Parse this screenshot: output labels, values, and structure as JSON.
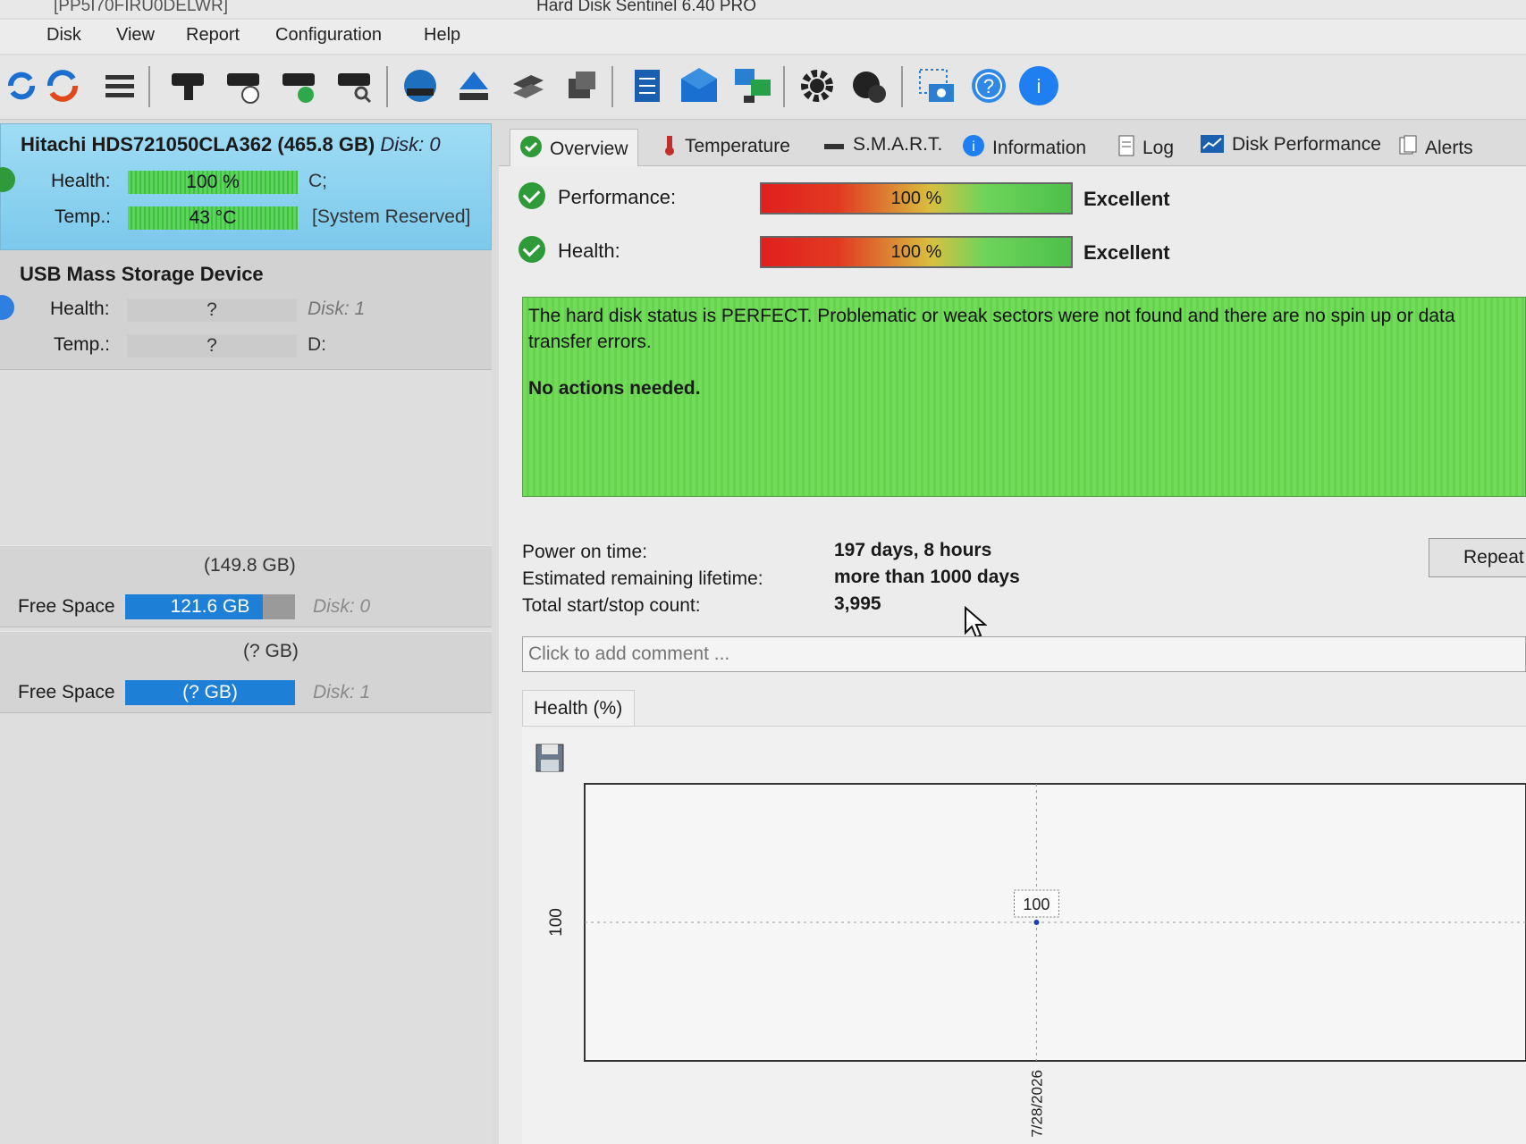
{
  "window": {
    "title": "Hard Disk Sentinel 6.40 PRO",
    "title_left": "[PP5I70FIRU0DELWR]"
  },
  "menu": [
    "Disk",
    "View",
    "Report",
    "Configuration",
    "Help"
  ],
  "disks": [
    {
      "name": "Hitachi HDS721050CLA362",
      "size": "(465.8 GB)",
      "disk_label": "Disk: 0",
      "health_label": "Health:",
      "health_value": "100 %",
      "health_fraction": 1.0,
      "health_side": "C;",
      "temp_label": "Temp.:",
      "temp_value": "43 °C",
      "temp_side": "[System Reserved]"
    },
    {
      "name": "USB Mass Storage Device",
      "health_label": "Health:",
      "health_value": "?",
      "health_side": "Disk: 1",
      "temp_label": "Temp.:",
      "temp_value": "?",
      "temp_side": "D:"
    }
  ],
  "volumes": [
    {
      "size": "(149.8 GB)",
      "free_label": "Free Space",
      "free_value": "121.6 GB",
      "free_fraction": 0.81,
      "disk": "Disk: 0"
    },
    {
      "size": "(? GB)",
      "free_label": "Free Space",
      "free_value": "(? GB)",
      "free_fraction": 1.0,
      "disk": "Disk: 1"
    }
  ],
  "tabs": [
    "Overview",
    "Temperature",
    "S.M.A.R.T.",
    "Information",
    "Log",
    "Disk Performance",
    "Alerts"
  ],
  "overview": {
    "performance_label": "Performance:",
    "performance_value": "100 %",
    "performance_word": "Excellent",
    "health_label": "Health:",
    "health_value": "100 %",
    "health_word": "Excellent",
    "status_text": "The hard disk status is PERFECT. Problematic or weak sectors were not found and there are no spin up or data transfer errors.",
    "action_text": "No actions needed.",
    "power_on_label": "Power on time:",
    "power_on_value": "197 days, 8 hours",
    "lifetime_label": "Estimated remaining lifetime:",
    "lifetime_value": "more than 1000 days",
    "startstop_label": "Total start/stop count:",
    "startstop_value": "3,995",
    "repeat_label": "Repeat Test",
    "comment_placeholder": "Click to add comment ...",
    "chart_tab_label": "Health (%)"
  },
  "colors": {
    "selected_disk": "#8fd3f0",
    "status_green": "#6cd852",
    "free_space_blue": "#1d7fd6",
    "ok_green": "#2f9a3a"
  },
  "chart_data": {
    "type": "line",
    "x": [
      "7/28/2026"
    ],
    "values": [
      100
    ],
    "point_labels": [
      "100"
    ],
    "ylabel": "100",
    "grid": true
  }
}
